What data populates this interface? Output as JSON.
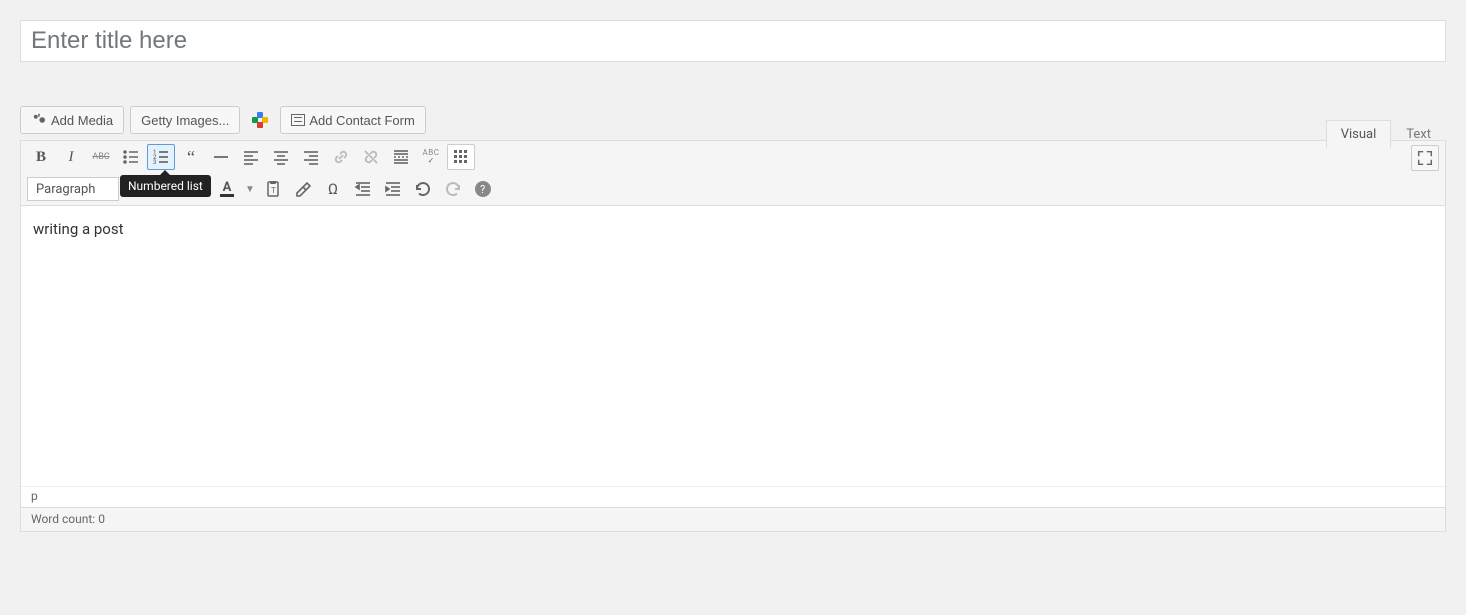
{
  "title": {
    "placeholder": "Enter title here",
    "value": ""
  },
  "media_buttons": {
    "add_media": "Add Media",
    "getty": "Getty Images...",
    "contact_form": "Add Contact Form"
  },
  "tabs": {
    "visual": "Visual",
    "text": "Text",
    "active": "visual"
  },
  "toolbar": {
    "format_select": "Paragraph",
    "tooltip_numbered_list": "Numbered list"
  },
  "editor": {
    "content": "writing a post",
    "path": "p",
    "word_count_label": "Word count:",
    "word_count_value": 0
  }
}
